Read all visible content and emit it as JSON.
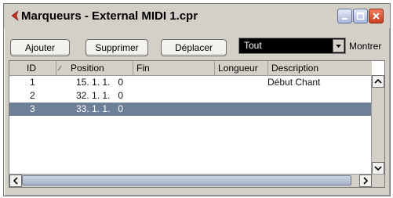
{
  "window": {
    "title": "Marqueurs - External MIDI 1.cpr",
    "colors": {
      "window_bg": "#d4d0c8",
      "selected_row": "#6e7f98",
      "close_button": "#c8401e"
    }
  },
  "toolbar": {
    "add_label": "Ajouter",
    "remove_label": "Supprimer",
    "move_label": "Déplacer",
    "filter_value": "Tout",
    "show_label": "Montrer"
  },
  "table": {
    "columns": {
      "id": "ID",
      "position": "Position",
      "end": "Fin",
      "length": "Longueur",
      "description": "Description"
    },
    "rows": [
      {
        "id": "1",
        "position": "15. 1. 1.   0",
        "end": "",
        "length": "",
        "description": "Début Chant",
        "selected": false
      },
      {
        "id": "2",
        "position": "32. 1. 1.   0",
        "end": "",
        "length": "",
        "description": "",
        "selected": false
      },
      {
        "id": "3",
        "position": "33. 1. 1.   0",
        "end": "",
        "length": "",
        "description": "",
        "selected": true
      }
    ]
  },
  "icons": {
    "app": "red-arrow-icon",
    "minimize": "minimize-icon",
    "maximize": "maximize-icon",
    "close": "close-icon",
    "sort": "sort-icon",
    "dropdown": "chevron-down-icon",
    "scroll_up": "scroll-up-icon",
    "scroll_down": "scroll-down-icon",
    "scroll_left": "scroll-left-icon",
    "scroll_right": "scroll-right-icon"
  }
}
